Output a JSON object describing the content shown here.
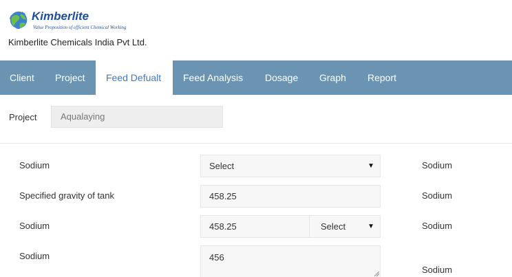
{
  "brand": {
    "logo_name": "Kimberlite",
    "tagline": "Value Proposition of efficient Chemical Working",
    "company": "Kimberlite Chemicals India Pvt Ltd."
  },
  "nav": {
    "items": [
      {
        "label": "Client",
        "active": false
      },
      {
        "label": "Project",
        "active": false
      },
      {
        "label": "Feed Defualt",
        "active": true
      },
      {
        "label": "Feed Analysis",
        "active": false
      },
      {
        "label": "Dosage",
        "active": false
      },
      {
        "label": "Graph",
        "active": false
      },
      {
        "label": "Report",
        "active": false
      }
    ]
  },
  "project": {
    "label": "Project",
    "value": "Aqualaying"
  },
  "rows": [
    {
      "label": "Sodium",
      "select_value": "Select",
      "unit": "Sodium"
    },
    {
      "label": "Specified gravity of tank",
      "value": "458.25",
      "unit": "Sodium"
    },
    {
      "label": "Sodium",
      "value": "458.25",
      "select_value": "Select",
      "unit": "Sodium"
    },
    {
      "label": "Sodium",
      "value": "456",
      "unit": "Sodium"
    }
  ],
  "colors": {
    "nav_bg": "#6a94b1",
    "active_tab_text": "#3a7bc8",
    "brand_blue": "#1e4f9e",
    "input_bg": "#f7f7f7"
  }
}
